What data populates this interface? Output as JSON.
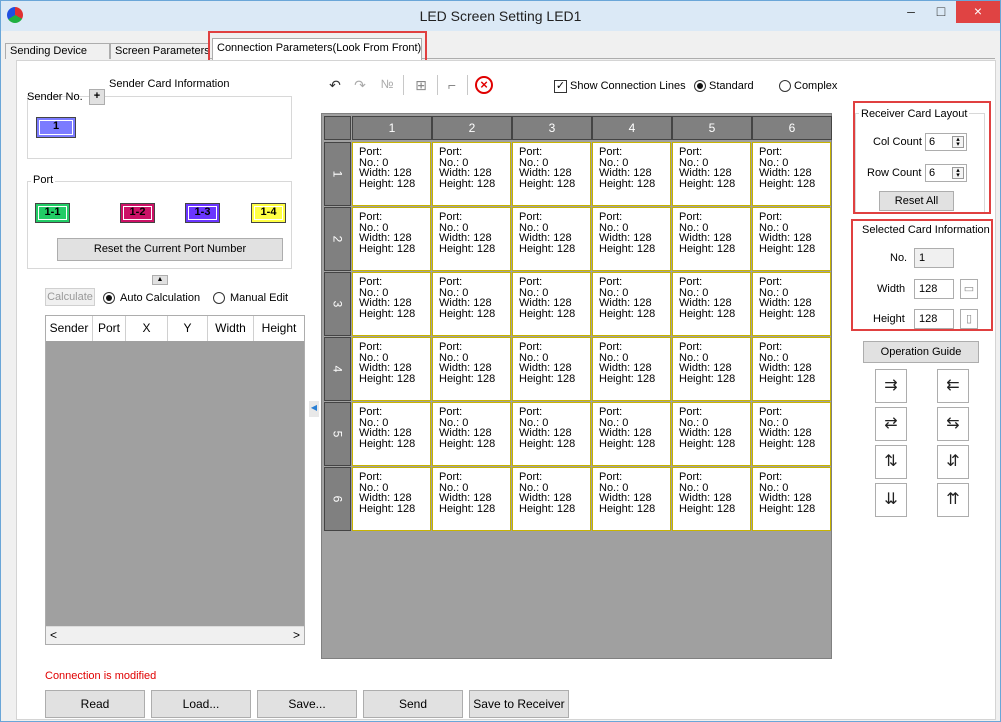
{
  "window": {
    "title": "LED Screen Setting LED1",
    "minimize": "–",
    "maximize": "□",
    "close": "×"
  },
  "tabs": [
    "Sending Device",
    "Screen Parameters",
    "Connection Parameters(Look From Front)"
  ],
  "sender_info": {
    "title": "Sender Card Information",
    "sender_no_label": "Sender No.",
    "add_label": "+",
    "sender_selected": "1"
  },
  "port": {
    "title": "Port",
    "ports": [
      "1-1",
      "1-2",
      "1-3",
      "1-4"
    ],
    "port_colors": [
      "#22cc66",
      "#cc1166",
      "#6a36ff",
      "#ffff44"
    ],
    "reset_label": "Reset the Current Port Number",
    "collapse_icon": "▲"
  },
  "calc": {
    "calculate_label": "Calculate",
    "auto_label": "Auto Calculation",
    "manual_label": "Manual Edit"
  },
  "table": {
    "columns": [
      "Sender",
      "Port",
      "X",
      "Y",
      "Width",
      "Height"
    ],
    "scroll_left": "<",
    "scroll_right": ">"
  },
  "status": {
    "message": "Connection is modified"
  },
  "bottom_buttons": [
    "Read",
    "Load...",
    "Save...",
    "Send",
    "Save to Receiver"
  ],
  "toolbar": {
    "show_lines_label": "Show Connection Lines",
    "standard_label": "Standard",
    "complex_label": "Complex",
    "side_arrow": "◀"
  },
  "grid": {
    "columns": [
      "1",
      "2",
      "3",
      "4",
      "5",
      "6"
    ],
    "rows": [
      "1",
      "2",
      "3",
      "4",
      "5",
      "6"
    ],
    "cell": {
      "port": "Port:",
      "no": "No.: 0",
      "width": "Width: 128",
      "height": "Height: 128"
    }
  },
  "receiver_layout": {
    "title": "Receiver Card Layout",
    "col_label": "Col Count",
    "col_value": "6",
    "row_label": "Row Count",
    "row_value": "6",
    "reset_label": "Reset All"
  },
  "selected_card": {
    "title": "Selected Card Information",
    "no_label": "No.",
    "no_value": "1",
    "width_label": "Width",
    "width_value": "128",
    "height_label": "Height",
    "height_value": "128"
  },
  "operation_guide": {
    "label": "Operation Guide"
  },
  "colors": {
    "highlight_red": "#e04040",
    "status_red": "#e00000",
    "cell_border": "#c8b400",
    "header_gray": "#808080"
  }
}
